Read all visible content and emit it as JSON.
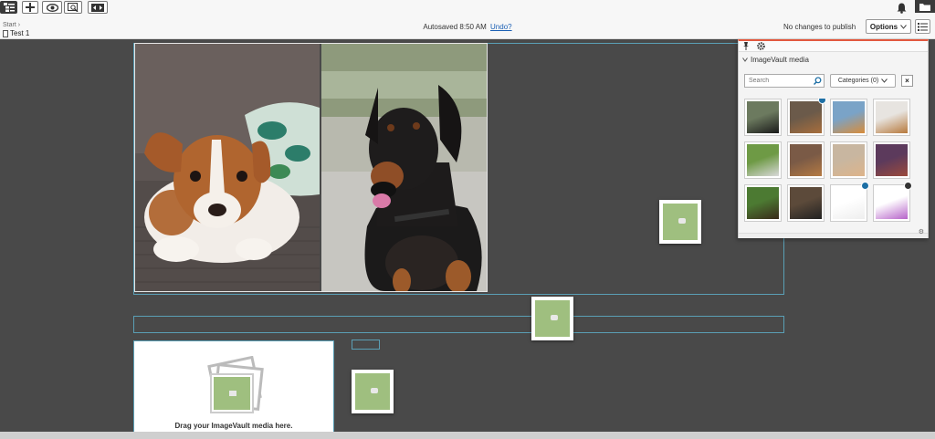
{
  "toolbar": {
    "buttons": [
      {
        "name": "navigation-pane-button",
        "icon": "tree-icon"
      },
      {
        "name": "add-button",
        "icon": "plus-icon"
      },
      {
        "name": "preview-button",
        "icon": "eye-icon"
      },
      {
        "name": "compare-button",
        "icon": "view-compare-icon"
      },
      {
        "name": "projects-button",
        "icon": "arrows-icon"
      }
    ],
    "notification_icon": "bell-icon",
    "assets_pane_icon": "folder-icon"
  },
  "breadcrumb": {
    "parent": "Start",
    "separator": "›",
    "current": "Test 1"
  },
  "status": {
    "autosaved": "Autosaved 8:50 AM",
    "undo_link": "Undo?",
    "publish": "No changes to publish"
  },
  "options": {
    "label": "Options"
  },
  "imagevault": {
    "title": "ImageVault media",
    "search_placeholder": "Search",
    "categories": "Categories (0)",
    "clear": "×",
    "thumbs": [
      {
        "name": "doberman-thumb",
        "colors": [
          "#6c7a5f",
          "#1a1a1a"
        ]
      },
      {
        "name": "puppies-thumb",
        "colors": [
          "#6b5a4a",
          "#a86e3c"
        ],
        "badge": "info"
      },
      {
        "name": "flowers-thumb",
        "colors": [
          "#7aa3c7",
          "#d88c3a"
        ]
      },
      {
        "name": "puppy-jump-thumb",
        "colors": [
          "#e7e4e0",
          "#b7793c"
        ]
      },
      {
        "name": "dog-grass-thumb",
        "colors": [
          "#6e9a45",
          "#d9d9d9"
        ]
      },
      {
        "name": "sleeping-dog-thumb",
        "colors": [
          "#7a5a46",
          "#b57a43"
        ]
      },
      {
        "name": "dog-sand-thumb",
        "colors": [
          "#c8b6a0",
          "#ddb48a"
        ]
      },
      {
        "name": "dog-purple-thumb",
        "colors": [
          "#5c3a5c",
          "#9c4a3c"
        ]
      },
      {
        "name": "dog-lawn-thumb",
        "colors": [
          "#4c7a32",
          "#3a2a1a"
        ]
      },
      {
        "name": "dog-close-thumb",
        "colors": [
          "#5c4a3a",
          "#222222"
        ]
      },
      {
        "name": "blank-thumb",
        "colors": [
          "#ffffff",
          "#eeeeee"
        ],
        "badge": "info"
      },
      {
        "name": "stack-thumb",
        "colors": [
          "#ffffff",
          "#b663c9"
        ],
        "badge": "share"
      }
    ]
  },
  "dropzone": {
    "label": "Drag your ImageVault media here."
  }
}
